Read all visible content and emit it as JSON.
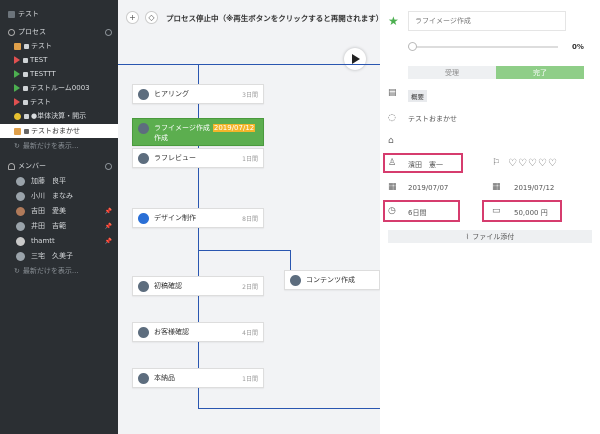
{
  "sidebar": {
    "top_item": "テスト",
    "process_header": "プロセス",
    "processes": [
      {
        "label": "テスト",
        "icon": "orange-square-icon"
      },
      {
        "label": "TEST",
        "icon": "red-triangle-icon"
      },
      {
        "label": "TESTTT",
        "icon": "green-triangle-icon"
      },
      {
        "label": "テストルーム0003",
        "icon": "green-triangle-icon"
      },
      {
        "label": "テスト",
        "icon": "red-triangle-icon"
      },
      {
        "label": "●単体決算・開示",
        "icon": "yellow-circle-icon"
      },
      {
        "label": "テストおまかせ",
        "icon": "orange-square-icon",
        "active": true
      }
    ],
    "show_latest_processes": "最新だけを表示...",
    "member_header": "メンバー",
    "members": [
      {
        "name": "加藤　良平"
      },
      {
        "name": "小川　まなみ"
      },
      {
        "name": "吉田　愛美",
        "pinned": true
      },
      {
        "name": "井田　吉範",
        "pinned": true
      },
      {
        "name": "thamtt",
        "pinned": true
      },
      {
        "name": "三宅　久美子"
      }
    ],
    "show_latest_members": "最新だけを表示..."
  },
  "canvas": {
    "add_button": "+",
    "tag_button": "◇",
    "title": "プロセス停止中（※再生ボタンをクリックすると再開されます）",
    "nodes": [
      {
        "name": "ヒアリング",
        "days": "3日間"
      },
      {
        "name": "ラフイメージ作成",
        "date": "2019/07/12",
        "extra": "作成"
      },
      {
        "name": "ラフレビュー",
        "days": "1日間"
      },
      {
        "name": "デザイン制作",
        "days": "8日間"
      },
      {
        "name": "コンテンツ作成",
        "days": "3日間"
      },
      {
        "name": "初稿確認",
        "days": "2日間"
      },
      {
        "name": "お客様確認",
        "days": "4日間"
      },
      {
        "name": "本納品",
        "days": "1日間"
      }
    ]
  },
  "panel": {
    "task_name": "ラフイメージ作成",
    "progress_percent": 0,
    "progress_label": "0%",
    "accept_button": "受理",
    "complete_button": "完了",
    "tag_label": "概要",
    "description": "テストおまかせ",
    "assignee": "濱田　憲一",
    "start_date": "2019/07/07",
    "end_date": "2019/07/12",
    "duration": "6日間",
    "budget": "50,000 円",
    "attach_button": "ファイル添付"
  },
  "colors": {
    "sidebar_bg": "#2b2f33",
    "accent_green": "#5cae4f",
    "highlight": "#f4b52a",
    "connector": "#2a56b0",
    "annotation_red": "#d63c6e"
  }
}
